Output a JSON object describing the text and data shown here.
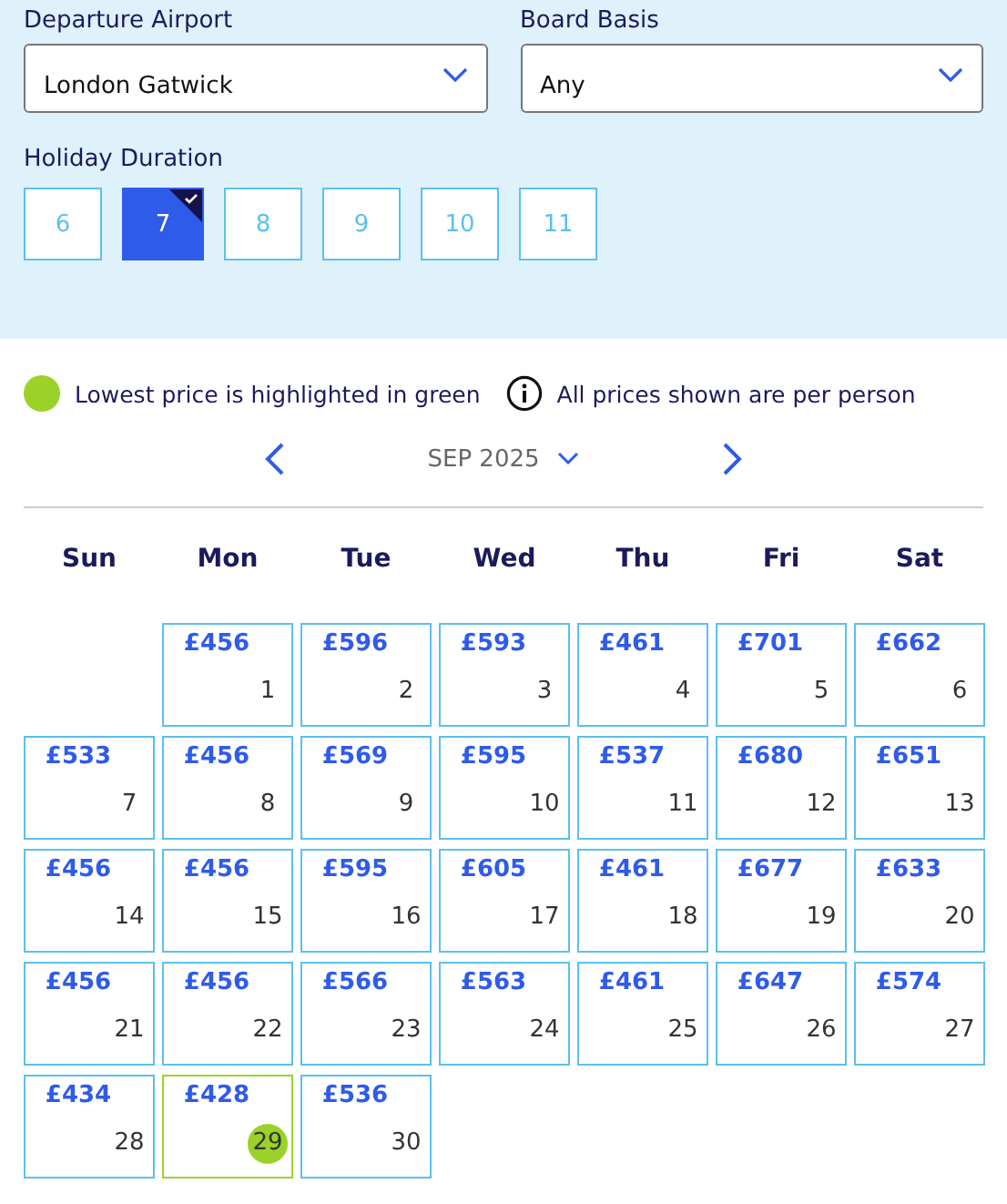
{
  "filters": [
    {
      "label": "Departure Airport",
      "value": "London Gatwick"
    },
    {
      "label": "Board Basis",
      "value": "Any"
    }
  ],
  "duration": {
    "label": "Holiday Duration",
    "options": [
      {
        "label": "6",
        "selected": false
      },
      {
        "label": "7",
        "selected": true
      },
      {
        "label": "8",
        "selected": false
      },
      {
        "label": "9",
        "selected": false
      },
      {
        "label": "10",
        "selected": false
      },
      {
        "label": "11",
        "selected": false
      }
    ]
  },
  "legend": {
    "lowest_note": "Lowest price is highlighted in green",
    "info_note": "All prices shown are per person"
  },
  "month": "SEP 2025",
  "weekdays": [
    "Sun",
    "Mon",
    "Tue",
    "Wed",
    "Thu",
    "Fri",
    "Sat"
  ],
  "weeks": [
    [
      {
        "kind": "empty"
      },
      {
        "price": "£456",
        "day": "1",
        "lowest": false
      },
      {
        "price": "£596",
        "day": "2",
        "lowest": false
      },
      {
        "price": "£593",
        "day": "3",
        "lowest": false
      },
      {
        "price": "£461",
        "day": "4",
        "lowest": false
      },
      {
        "price": "£701",
        "day": "5",
        "lowest": false
      },
      {
        "price": "£662",
        "day": "6",
        "lowest": false
      }
    ],
    [
      {
        "price": "£533",
        "day": "7",
        "lowest": false
      },
      {
        "price": "£456",
        "day": "8",
        "lowest": false
      },
      {
        "price": "£569",
        "day": "9",
        "lowest": false
      },
      {
        "price": "£595",
        "day": "10",
        "lowest": false
      },
      {
        "price": "£537",
        "day": "11",
        "lowest": false
      },
      {
        "price": "£680",
        "day": "12",
        "lowest": false
      },
      {
        "price": "£651",
        "day": "13",
        "lowest": false
      }
    ],
    [
      {
        "price": "£456",
        "day": "14",
        "lowest": false
      },
      {
        "price": "£456",
        "day": "15",
        "lowest": false
      },
      {
        "price": "£595",
        "day": "16",
        "lowest": false
      },
      {
        "price": "£605",
        "day": "17",
        "lowest": false
      },
      {
        "price": "£461",
        "day": "18",
        "lowest": false
      },
      {
        "price": "£677",
        "day": "19",
        "lowest": false
      },
      {
        "price": "£633",
        "day": "20",
        "lowest": false
      }
    ],
    [
      {
        "price": "£456",
        "day": "21",
        "lowest": false
      },
      {
        "price": "£456",
        "day": "22",
        "lowest": false
      },
      {
        "price": "£566",
        "day": "23",
        "lowest": false
      },
      {
        "price": "£563",
        "day": "24",
        "lowest": false
      },
      {
        "price": "£461",
        "day": "25",
        "lowest": false
      },
      {
        "price": "£647",
        "day": "26",
        "lowest": false
      },
      {
        "price": "£574",
        "day": "27",
        "lowest": false
      }
    ],
    [
      {
        "price": "£434",
        "day": "28",
        "lowest": false
      },
      {
        "price": "£428",
        "day": "29",
        "lowest": true
      },
      {
        "price": "£536",
        "day": "30",
        "lowest": false
      }
    ]
  ]
}
